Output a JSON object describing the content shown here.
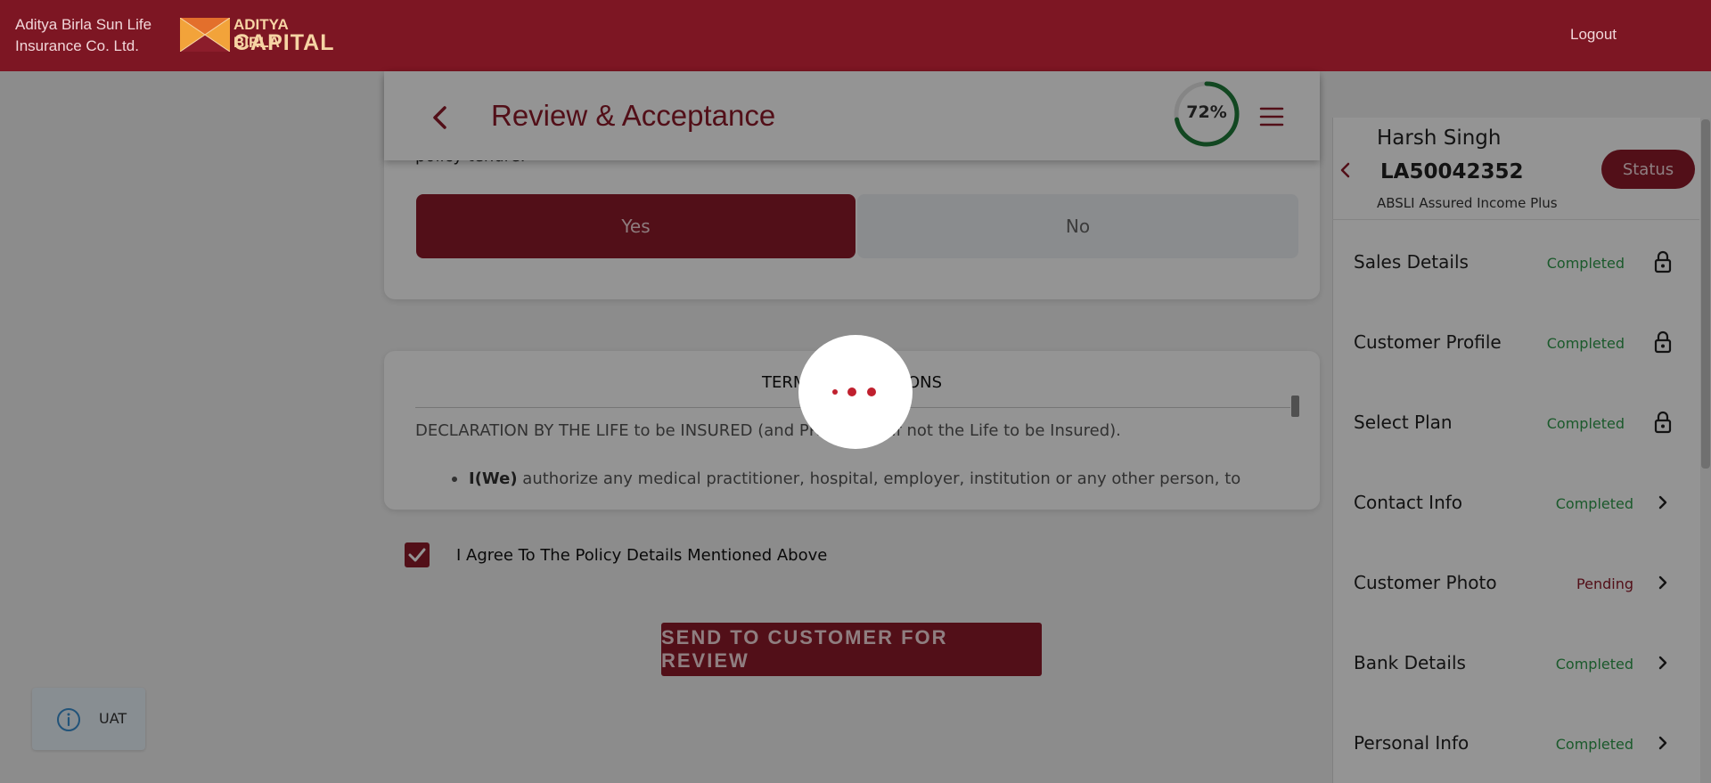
{
  "header": {
    "company_line1": "Aditya Birla Sun Life",
    "company_line2": "Insurance Co. Ltd.",
    "logo_line1": "ADITYA BIRLA",
    "logo_line2": "CAPITAL",
    "logout_label": "Logout"
  },
  "page": {
    "title": "Review & Acceptance",
    "progress_percent": 72,
    "progress_label": "72%"
  },
  "question": {
    "text_fragment": "policy tenure.",
    "yes_label": "Yes",
    "no_label": "No",
    "selected": "Yes"
  },
  "terms": {
    "title": "TERMS & CONDITIONS",
    "declaration": "DECLARATION BY THE LIFE to be INSURED (and PROPOSER if not the Life to be Insured).",
    "bullet_bold": "I(We)",
    "bullet_text": " authorize any medical practitioner, hospital, employer, institution or any other person, to"
  },
  "agreement": {
    "checked": true,
    "label": "I Agree To The Policy Details Mentioned Above"
  },
  "actions": {
    "send_label": "SEND TO CUSTOMER FOR REVIEW"
  },
  "customer": {
    "name": "Harsh Singh",
    "id": "LA50042352",
    "plan": "ABSLI Assured Income Plus",
    "status_label": "Status"
  },
  "steps": [
    {
      "label": "Sales Details",
      "status": "Completed",
      "icon": "lock-icon"
    },
    {
      "label": "Customer Profile",
      "status": "Completed",
      "icon": "lock-icon"
    },
    {
      "label": "Select Plan",
      "status": "Completed",
      "icon": "lock-icon"
    },
    {
      "label": "Contact Info",
      "status": "Completed",
      "icon": "chevron-right-icon"
    },
    {
      "label": "Customer Photo",
      "status": "Pending",
      "icon": "chevron-right-icon"
    },
    {
      "label": "Bank Details",
      "status": "Completed",
      "icon": "chevron-right-icon"
    },
    {
      "label": "Personal Info",
      "status": "Completed",
      "icon": "chevron-right-icon"
    }
  ],
  "env_badge": {
    "label": "UAT",
    "icon": "info-icon"
  },
  "colors": {
    "brand_red": "#7d1623",
    "primary": "#8e1b2a",
    "completed": "#2e9a4a",
    "progress_ring": "#1f7a3a"
  }
}
